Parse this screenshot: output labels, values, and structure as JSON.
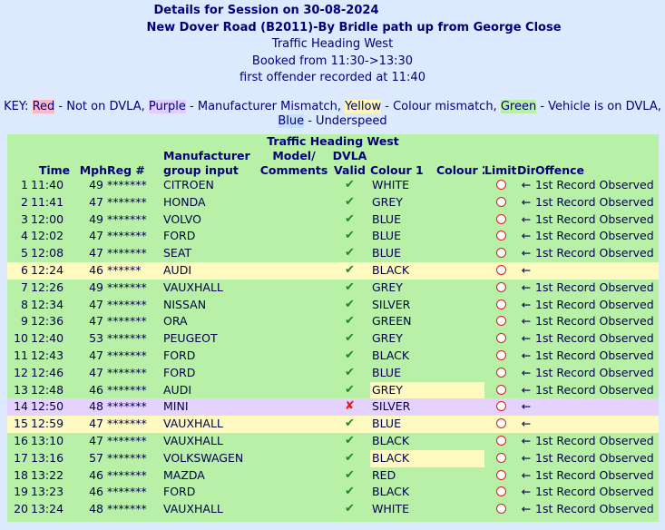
{
  "header": {
    "title": "Details for Session on 30-08-2024",
    "location": "New Dover Road (B2011)-By Bridle path  up from George Close",
    "direction": "Traffic Heading West",
    "booked": "Booked from 11:30->13:30",
    "first_offender": "first offender recorded at 11:40"
  },
  "key": {
    "prefix": "KEY:",
    "red": "Red",
    "red_desc": " - Not on DVLA, ",
    "purple": "Purple",
    "purple_desc": " - Manufacturer Mismatch, ",
    "yellow": "Yellow",
    "yellow_desc": " - Colour mismatch, ",
    "green": "Green",
    "green_desc": " - Vehicle is on DVLA,",
    "blue": "Blue",
    "blue_desc": " - Underspeed",
    "colors": {
      "red": "#ffb6c1",
      "purple": "#e3ccff",
      "yellow": "#fff8b0",
      "green": "#b8f0a8",
      "blue": "#c7e0ff"
    }
  },
  "table": {
    "caption": "Traffic Heading West",
    "columns": {
      "time": "Time",
      "mph": "Mph",
      "reg": "Reg #",
      "mfr_line1": "Manufacturer",
      "mfr_line2": "group input",
      "model_line1": "Model/",
      "model_line2": "Comments",
      "dvla_line1": "DVLA",
      "dvla_line2": "Valid",
      "colour1": "Colour 1",
      "colour2": "Colour 2",
      "limit": "Limit",
      "dir": "Dir",
      "offence": "Offence"
    },
    "rows": [
      {
        "n": "1",
        "time": "11:40",
        "mph": "49",
        "reg": "*******",
        "mfr": "CITROEN",
        "valid": "✔",
        "colour1": "WHITE",
        "dir": "←",
        "offence": "1st Record Observed",
        "status": "green"
      },
      {
        "n": "2",
        "time": "11:41",
        "mph": "47",
        "reg": "*******",
        "mfr": "HONDA",
        "valid": "✔",
        "colour1": "GREY",
        "dir": "←",
        "offence": "1st Record Observed",
        "status": "green"
      },
      {
        "n": "3",
        "time": "12:00",
        "mph": "49",
        "reg": "*******",
        "mfr": "VOLVO",
        "valid": "✔",
        "colour1": "BLUE",
        "dir": "←",
        "offence": "1st Record Observed",
        "status": "green"
      },
      {
        "n": "4",
        "time": "12:02",
        "mph": "47",
        "reg": "*******",
        "mfr": "FORD",
        "valid": "✔",
        "colour1": "BLUE",
        "dir": "←",
        "offence": "1st Record Observed",
        "status": "green"
      },
      {
        "n": "5",
        "time": "12:08",
        "mph": "47",
        "reg": "*******",
        "mfr": "SEAT",
        "valid": "✔",
        "colour1": "BLUE",
        "dir": "←",
        "offence": "1st Record Observed",
        "status": "green"
      },
      {
        "n": "6",
        "time": "12:24",
        "mph": "46",
        "reg": "******",
        "mfr": "AUDI",
        "valid": "✔",
        "colour1": "BLACK",
        "dir": "←",
        "offence": "",
        "status": "yellow"
      },
      {
        "n": "7",
        "time": "12:26",
        "mph": "49",
        "reg": "*******",
        "mfr": "VAUXHALL",
        "valid": "✔",
        "colour1": "GREY",
        "dir": "←",
        "offence": "1st Record Observed",
        "status": "green"
      },
      {
        "n": "8",
        "time": "12:34",
        "mph": "47",
        "reg": "*******",
        "mfr": "NISSAN",
        "valid": "✔",
        "colour1": "SILVER",
        "dir": "←",
        "offence": "1st Record Observed",
        "status": "green"
      },
      {
        "n": "9",
        "time": "12:36",
        "mph": "47",
        "reg": "*******",
        "mfr": "ORA",
        "valid": "✔",
        "colour1": "GREEN",
        "dir": "←",
        "offence": "1st Record Observed",
        "status": "green"
      },
      {
        "n": "10",
        "time": "12:40",
        "mph": "53",
        "reg": "*******",
        "mfr": "PEUGEOT",
        "valid": "✔",
        "colour1": "GREY",
        "dir": "←",
        "offence": "1st Record Observed",
        "status": "green"
      },
      {
        "n": "11",
        "time": "12:43",
        "mph": "47",
        "reg": "*******",
        "mfr": "FORD",
        "valid": "✔",
        "colour1": "BLACK",
        "dir": "←",
        "offence": "1st Record Observed",
        "status": "green"
      },
      {
        "n": "12",
        "time": "12:46",
        "mph": "47",
        "reg": "*******",
        "mfr": "FORD",
        "valid": "✔",
        "colour1": "BLUE",
        "dir": "←",
        "offence": "1st Record Observed",
        "status": "green"
      },
      {
        "n": "13",
        "time": "12:48",
        "mph": "46",
        "reg": "*******",
        "mfr": "AUDI",
        "valid": "✔",
        "colour1": "GREY",
        "dir": "←",
        "offence": "1st Record Observed",
        "status": "green",
        "hl_colour": true
      },
      {
        "n": "14",
        "time": "12:50",
        "mph": "48",
        "reg": "*******",
        "mfr": "MINI",
        "valid": "✘",
        "colour1": "SILVER",
        "dir": "←",
        "offence": "",
        "status": "purple"
      },
      {
        "n": "15",
        "time": "12:59",
        "mph": "47",
        "reg": "*******",
        "mfr": "VAUXHALL",
        "valid": "✔",
        "colour1": "BLUE",
        "dir": "←",
        "offence": "",
        "status": "yellow"
      },
      {
        "n": "16",
        "time": "13:10",
        "mph": "47",
        "reg": "*******",
        "mfr": "VAUXHALL",
        "valid": "✔",
        "colour1": "BLACK",
        "dir": "←",
        "offence": "1st Record Observed",
        "status": "green"
      },
      {
        "n": "17",
        "time": "13:16",
        "mph": "57",
        "reg": "*******",
        "mfr": "VOLKSWAGEN",
        "valid": "✔",
        "colour1": "BLACK",
        "dir": "←",
        "offence": "1st Record Observed",
        "status": "green",
        "hl_colour": true
      },
      {
        "n": "18",
        "time": "13:22",
        "mph": "46",
        "reg": "*******",
        "mfr": "MAZDA",
        "valid": "✔",
        "colour1": "RED",
        "dir": "←",
        "offence": "1st Record Observed",
        "status": "green"
      },
      {
        "n": "19",
        "time": "13:23",
        "mph": "46",
        "reg": "*******",
        "mfr": "FORD",
        "valid": "✔",
        "colour1": "BLACK",
        "dir": "←",
        "offence": "1st Record Observed",
        "status": "green"
      },
      {
        "n": "20",
        "time": "13:24",
        "mph": "48",
        "reg": "*******",
        "mfr": "VAUXHALL",
        "valid": "✔",
        "colour1": "WHITE",
        "dir": "←",
        "offence": "1st Record Observed",
        "status": "green"
      }
    ]
  }
}
